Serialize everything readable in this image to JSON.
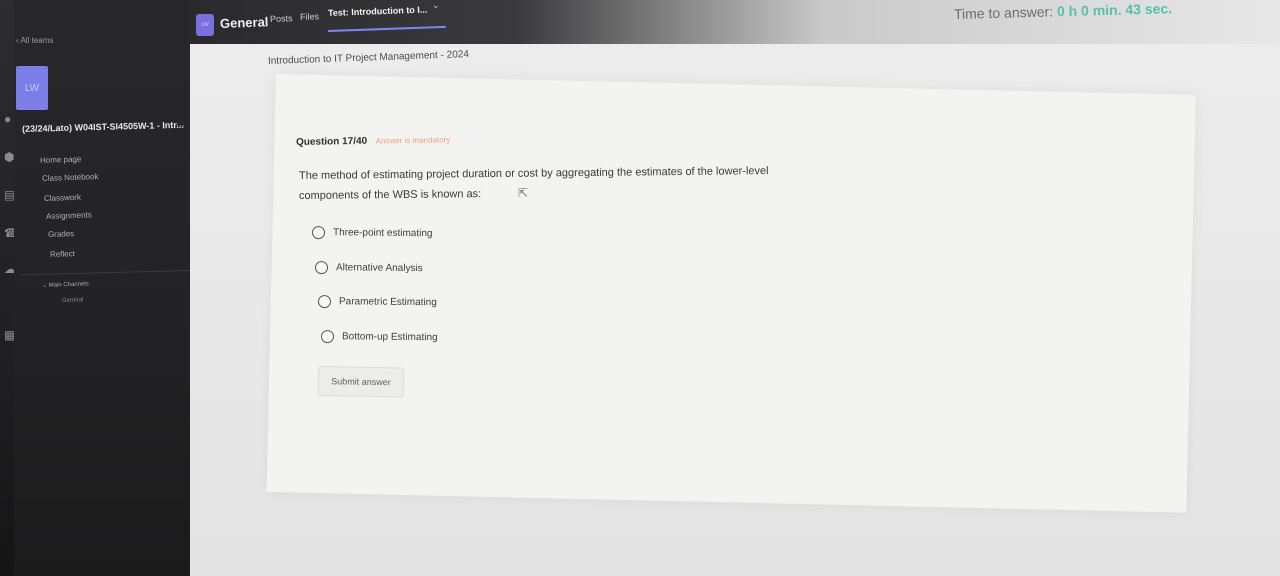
{
  "topbar": {
    "channel_icon": "LW",
    "channel_name": "General",
    "tabs": [
      "Posts",
      "Files",
      "Test: Introduction to I..."
    ],
    "active_tab_index": 2,
    "timer_label": "Time to answer:",
    "timer_value": "0 h 0 min. 43 sec."
  },
  "sidebar": {
    "back_label": "All teams",
    "team_avatar": "LW",
    "team_name": "(23/24/Lato) W04IST-SI4505W-1 - Intr...",
    "more_label": "···",
    "nav": [
      "Home page",
      "Class Notebook",
      "Classwork",
      "Assignments",
      "Grades",
      "Reflect"
    ],
    "main_channels_label": "Main Channels",
    "channels": [
      "General"
    ]
  },
  "rail": {
    "labels": [
      "Activity",
      "Chat",
      "Teams",
      "Calendar",
      "Calls",
      "OneDrive",
      "Apps"
    ]
  },
  "quiz": {
    "course_title": "Introduction to IT Project Management - 2024",
    "question_number": "Question 17/40",
    "mandatory": "Answer is mandatory",
    "question_line1": "The method of estimating project duration or cost by aggregating the estimates of the lower-level",
    "question_line2": "components of the WBS is known as:",
    "options": [
      "Three-point estimating",
      "Alternative Analysis",
      "Parametric Estimating",
      "Bottom-up Estimating"
    ],
    "submit_label": "Submit answer"
  },
  "colors": {
    "accent": "#7f85f5",
    "timer": "#56c2a4",
    "mandatory": "#e8a27d"
  }
}
